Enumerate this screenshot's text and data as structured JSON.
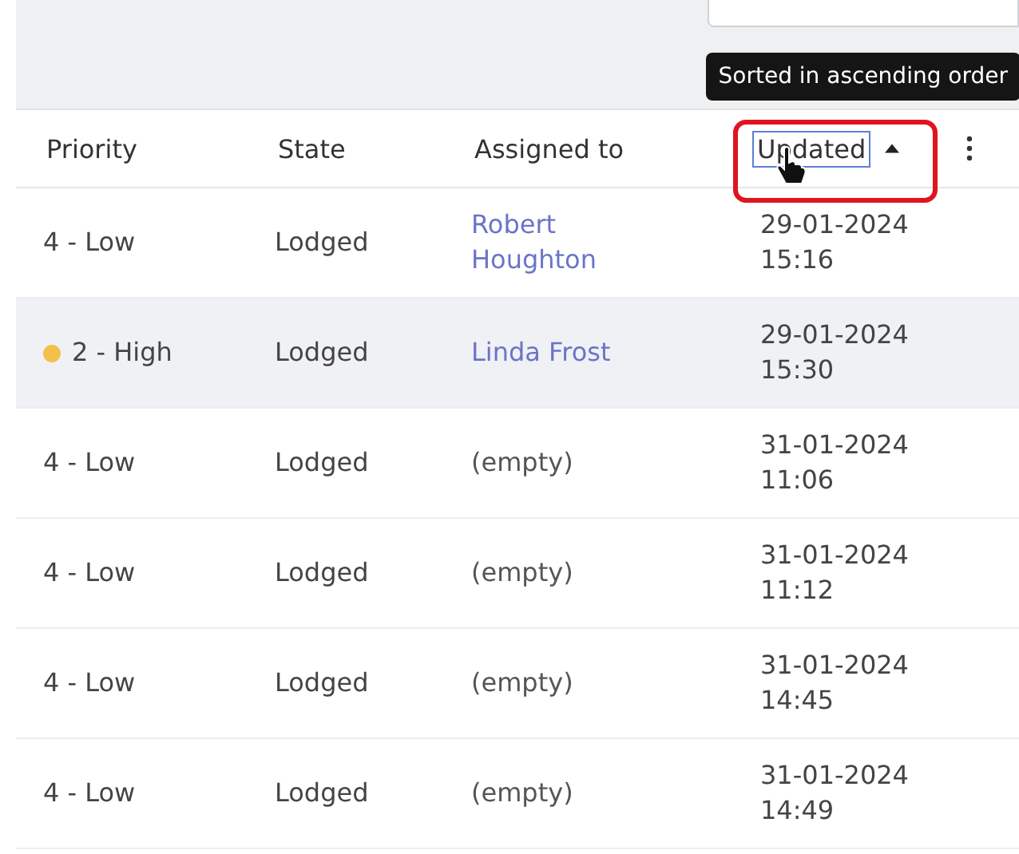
{
  "tooltip": "Sorted in ascending order",
  "columns": [
    {
      "label": "Priority",
      "sorted": false
    },
    {
      "label": "State",
      "sorted": false
    },
    {
      "label": "Assigned to",
      "sorted": false
    },
    {
      "label": "Updated",
      "sorted": true,
      "focused": true
    }
  ],
  "rows": [
    {
      "priority": "4 - Low",
      "state": "Lodged",
      "assigned": {
        "text": "Robert Houghton",
        "kind": "link"
      },
      "updated": "29-01-2024 15:16",
      "highlighted": false
    },
    {
      "priority": "2 - High",
      "color": "#f5c04a",
      "state": "Lodged",
      "assigned": {
        "text": "Linda Frost",
        "kind": "link"
      },
      "updated": "29-01-2024 15:30",
      "highlighted": true
    },
    {
      "priority": "4 - Low",
      "state": "Lodged",
      "assigned": {
        "text": "(empty)",
        "kind": "empty"
      },
      "updated": "31-01-2024 11:06",
      "highlighted": false
    },
    {
      "priority": "4 - Low",
      "state": "Lodged",
      "assigned": {
        "text": "(empty)",
        "kind": "empty"
      },
      "updated": "31-01-2024 11:12",
      "highlighted": false
    },
    {
      "priority": "4 - Low",
      "state": "Lodged",
      "assigned": {
        "text": "(empty)",
        "kind": "empty"
      },
      "updated": "31-01-2024 14:45",
      "highlighted": false
    },
    {
      "priority": "4 - Low",
      "state": "Lodged",
      "assigned": {
        "text": "(empty)",
        "kind": "empty"
      },
      "updated": "31-01-2024 14:49",
      "highlighted": false
    }
  ]
}
